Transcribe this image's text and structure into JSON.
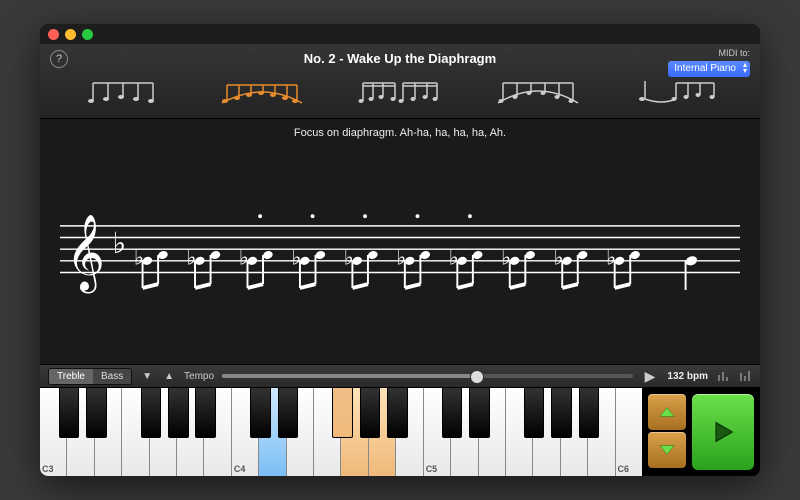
{
  "window": {
    "title": "No. 2 - Wake Up the Diaphragm"
  },
  "midi": {
    "label": "MIDI to:",
    "selected": "Internal Piano",
    "options": [
      "Internal Piano"
    ]
  },
  "patterns": {
    "count": 5,
    "selected_index": 1
  },
  "instruction": "Focus on diaphragm. Ah-ha, ha, ha, ha, Ah.",
  "controls": {
    "clef_treble": "Treble",
    "clef_bass": "Bass",
    "clef_active": "Treble",
    "tempo_label": "Tempo",
    "tempo_bpm": "132 bpm",
    "tempo_slider_percent": 62
  },
  "keyboard": {
    "white_count": 22,
    "octave_labels": [
      {
        "index": 0,
        "text": "C3"
      },
      {
        "index": 7,
        "text": "C4"
      },
      {
        "index": 14,
        "text": "C5"
      },
      {
        "index": 21,
        "text": "C6"
      }
    ],
    "white_highlights": [
      {
        "index": 8,
        "color": "blue"
      },
      {
        "index": 11,
        "color": "orange"
      },
      {
        "index": 12,
        "color": "orange"
      }
    ],
    "black_highlights": [
      {
        "after_white_index": 10,
        "color": "orange"
      }
    ]
  },
  "icons": {
    "help": "?",
    "prev_pattern": "◀",
    "next_pattern": "▶",
    "tri_down": "▼",
    "tri_up": "▲"
  }
}
